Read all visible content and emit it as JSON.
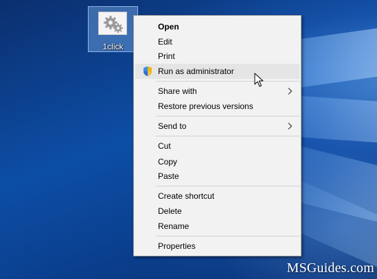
{
  "desktop": {
    "icon": {
      "label": "1click",
      "thumb_icon": "gears-icon"
    }
  },
  "context_menu": {
    "items": [
      {
        "label": "Open"
      },
      {
        "label": "Edit"
      },
      {
        "label": "Print"
      },
      {
        "label": "Run as administrator",
        "icon": "uac-shield-icon"
      },
      {
        "label": "Share with",
        "submenu_icon": "chevron-right-icon"
      },
      {
        "label": "Restore previous versions"
      },
      {
        "label": "Send to",
        "submenu_icon": "chevron-right-icon"
      },
      {
        "label": "Cut"
      },
      {
        "label": "Copy"
      },
      {
        "label": "Paste"
      },
      {
        "label": "Create shortcut"
      },
      {
        "label": "Delete"
      },
      {
        "label": "Rename"
      },
      {
        "label": "Properties"
      }
    ]
  },
  "watermark": {
    "text": "MSGuides.com"
  },
  "colors": {
    "menu_background": "#f2f2f2",
    "menu_hover": "#e5e5e5",
    "desktop_blue": "#0d4ea6"
  }
}
